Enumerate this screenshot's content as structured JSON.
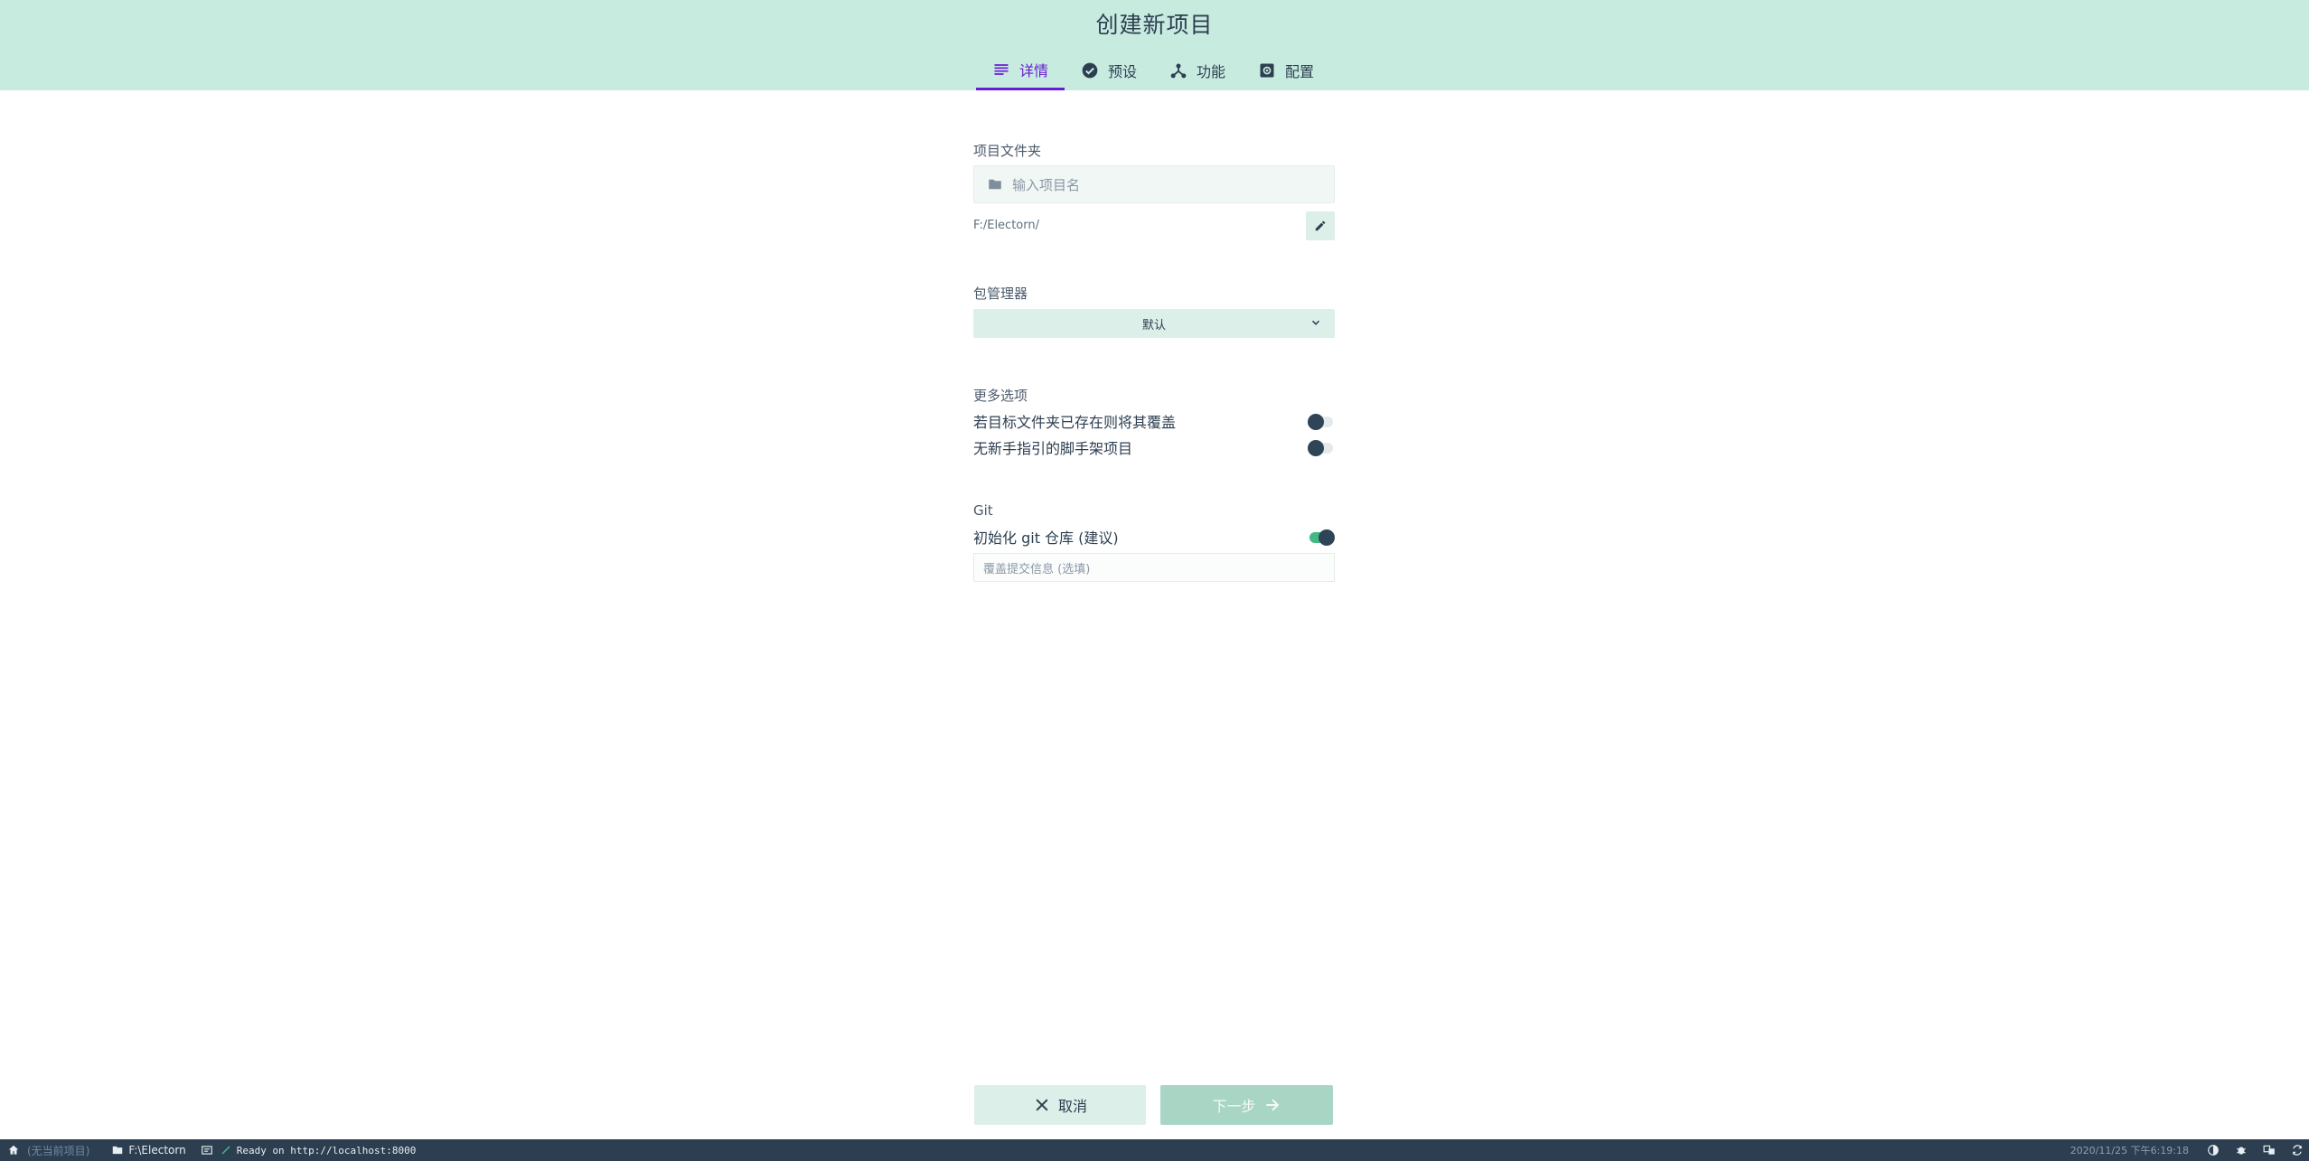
{
  "header": {
    "title": "创建新项目",
    "tabs": [
      {
        "label": "详情",
        "icon": "list-icon",
        "active": true
      },
      {
        "label": "预设",
        "icon": "check-circle-icon",
        "active": false
      },
      {
        "label": "功能",
        "icon": "hub-icon",
        "active": false
      },
      {
        "label": "配置",
        "icon": "settings-box-icon",
        "active": false
      }
    ]
  },
  "form": {
    "project_folder": {
      "label": "项目文件夹",
      "placeholder": "输入项目名",
      "path": "F:/Electorn/"
    },
    "package_manager": {
      "label": "包管理器",
      "selected": "默认"
    },
    "more_options": {
      "label": "更多选项",
      "options": [
        {
          "label": "若目标文件夹已存在则将其覆盖",
          "enabled": false
        },
        {
          "label": "无新手指引的脚手架项目",
          "enabled": false
        }
      ]
    },
    "git": {
      "label": "Git",
      "init_label": "初始化 git 仓库 (建议)",
      "init_enabled": true,
      "commit_placeholder": "覆盖提交信息 (选填)"
    }
  },
  "actions": {
    "cancel_label": "取消",
    "next_label": "下一步"
  },
  "statusbar": {
    "no_project": "(无当前项目)",
    "folder": "F:\\Electorn",
    "log": "Ready on http://localhost:8000",
    "datetime": "2020/11/25 下午6:19:18"
  },
  "colors": {
    "header_bg": "#c8ebe0",
    "accent": "#6a1bd8",
    "toggle_on": "#42b983",
    "statusbar_bg": "#2c3e50"
  }
}
